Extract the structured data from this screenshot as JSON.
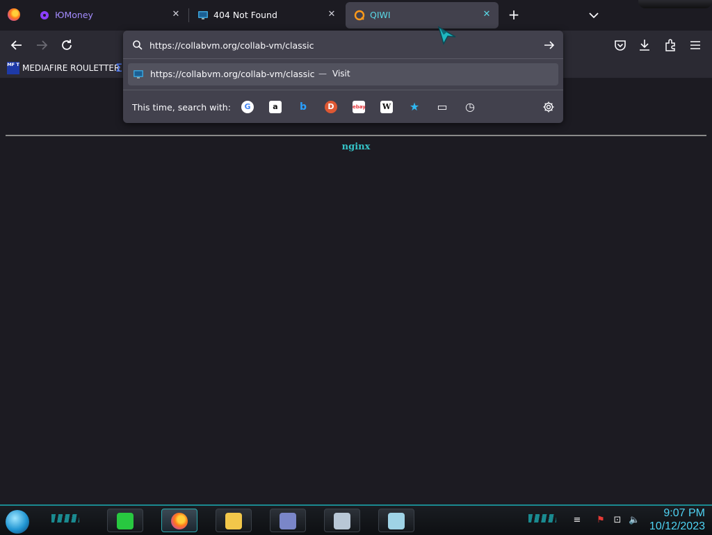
{
  "browser": {
    "tabs": [
      {
        "title": "ЮMoney",
        "color": "#a48cff",
        "icon": "yoomoney-icon"
      },
      {
        "title": "404 Not Found",
        "color": "#fbfbfe",
        "icon": "monitor-icon"
      },
      {
        "title": "QIWI",
        "color": "#5ad8e6",
        "icon": "qiwi-icon"
      }
    ],
    "close_glyph": "✕",
    "newtab_glyph": "+",
    "bookmarks": [
      {
        "label": "MEDIAFIRE ROULETTER",
        "icon_text": "MF T"
      }
    ]
  },
  "urlbar": {
    "value": "https://collabvm.org/collab-vm/classic",
    "suggestion": {
      "url": "https://collabvm.org/collab-vm/classic",
      "dash": "—",
      "action": "Visit"
    },
    "search_with_label": "This time, search with:",
    "engines": [
      {
        "name": "google-icon",
        "glyph": "G"
      },
      {
        "name": "amazon-icon",
        "glyph": "a"
      },
      {
        "name": "bing-icon",
        "glyph": "b"
      },
      {
        "name": "duckduckgo-icon",
        "glyph": "D"
      },
      {
        "name": "ebay-icon",
        "glyph": "ebay"
      },
      {
        "name": "wikipedia-icon",
        "glyph": "W"
      },
      {
        "name": "bookmarks-star-icon",
        "glyph": "★"
      },
      {
        "name": "tabs-icon",
        "glyph": "▭"
      },
      {
        "name": "history-icon",
        "glyph": "◷"
      }
    ]
  },
  "page": {
    "server": "nginx"
  },
  "taskbar": {
    "time": "9:07 PM",
    "date": "10/12/2023"
  },
  "colors": {
    "accent": "#35c4c8",
    "toolbar": "#2b2a33",
    "popup": "#42414d",
    "clock": "#4fd4f5"
  }
}
